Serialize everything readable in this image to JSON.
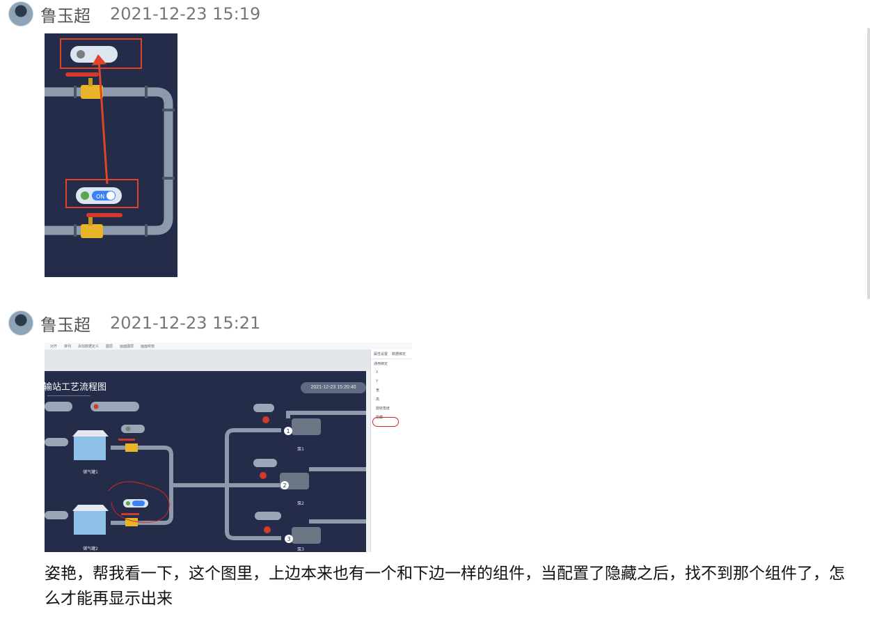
{
  "messages": [
    {
      "sender": "鲁玉超",
      "time": "2021-12-23 15:19"
    },
    {
      "sender": "鲁玉超",
      "time": "2021-12-23 15:21",
      "text": "姿艳，帮我看一下，这个图里，上边本来也有一个和下边一样的组件，当配置了隐藏之后，找不到那个组件了，怎么才能再显示出来"
    }
  ],
  "screenshot1": {
    "toggle_label": "ON"
  },
  "screenshot2": {
    "menu": [
      "对齐",
      "排列",
      "添加数据定义",
      "图层",
      "画面图层",
      "画面校核"
    ],
    "title": "输站工艺流程图",
    "datetime": "2021-12-23 15:20:40",
    "tank1": "储气罐1",
    "tank2": "储气罐2",
    "pumps": [
      "泵1",
      "泵2",
      "泵3"
    ],
    "pump_numbers": [
      "1",
      "2",
      "3"
    ],
    "panel_tabs": [
      "属性设置",
      "数据绑定"
    ],
    "panel_section": "通用绑定",
    "panel_rows": [
      "X",
      "Y",
      "宽",
      "高",
      "旋转角度",
      "隐藏"
    ]
  }
}
